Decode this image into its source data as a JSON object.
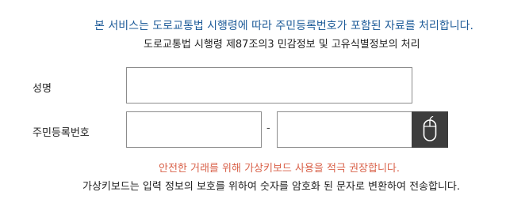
{
  "notice": {
    "main": "본 서비스는 도로교통법 시행령에 따라 주민등록번호가 포함된 자료를 처리합니다.",
    "sub": "도로교통법 시행령 제87조의3 민감정보 및 고유식별정보의 처리"
  },
  "form": {
    "name_label": "성명",
    "name_value": "",
    "rrn_label": "주민등록번호",
    "rrn_front_value": "",
    "rrn_back_value": "",
    "rrn_separator": "-",
    "keyboard_icon": "mouse-icon"
  },
  "messages": {
    "warning": "안전한 거래를 위해 가상키보드 사용을 적극 권장합니다.",
    "info": "가상키보드는 입력 정보의 보호를 위하여 숫자를 암호화 된 문자로 변환하여 전송합니다."
  },
  "colors": {
    "notice_main": "#1f5c99",
    "warning": "#d9624a",
    "keyboard_button_bg": "#3d3d3d"
  }
}
